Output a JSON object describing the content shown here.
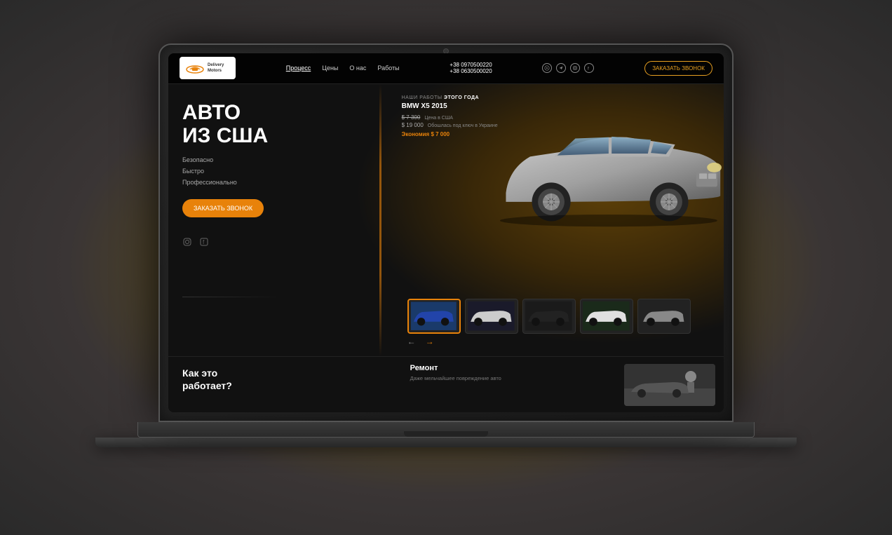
{
  "laptop": {
    "screen": "website"
  },
  "nav": {
    "logo_text": "DeliveryMotors",
    "links": [
      {
        "label": "Процесс",
        "active": true
      },
      {
        "label": "Цены",
        "active": false
      },
      {
        "label": "О нас",
        "active": false
      },
      {
        "label": "Работы",
        "active": false
      }
    ],
    "phone1": "+38 0970500220",
    "phone2": "+38 0630500020",
    "cta_label": "ЗАКАЗАТЬ ЗВОНОК"
  },
  "hero": {
    "title_line1": "АВТО",
    "title_line2": "из США",
    "benefits": [
      "Безопасно",
      "Быстро",
      "Профессионально"
    ],
    "cta_label": "ЗАКАЗАТЬ ЗВОНОК"
  },
  "car_info": {
    "section_label": "НАШИ РАБОТЫ",
    "section_highlight": "ЭТОГО ГОДА",
    "model": "BMW X5 2015",
    "price_usd_label": "$ 7 300",
    "price_usd_note": "Цена в США",
    "price_ua_label": "$ 19 000",
    "price_ua_note": "Обошлась под ключ в Украине",
    "savings": "Экономия $ 7 000"
  },
  "thumbnails": [
    {
      "id": 1,
      "active": true,
      "color": "#2244aa"
    },
    {
      "id": 2,
      "active": false,
      "color": "#ddd"
    },
    {
      "id": 3,
      "active": false,
      "color": "#111"
    },
    {
      "id": 4,
      "active": false,
      "color": "#eee"
    },
    {
      "id": 5,
      "active": false,
      "color": "#888"
    }
  ],
  "arrows": {
    "left": "←",
    "right": "→"
  },
  "bottom": {
    "title_line1": "Как это",
    "title_line2": "работает?",
    "remont_title": "Ремонт",
    "remont_desc": "Даже мельчайшее повреждение авто"
  },
  "social": {
    "instagram": "ig",
    "facebook": "f",
    "telegram": "tg",
    "whatsapp": "wa"
  },
  "colors": {
    "accent": "#e8820a",
    "bg": "#111111",
    "text_primary": "#ffffff",
    "text_secondary": "#888888"
  }
}
